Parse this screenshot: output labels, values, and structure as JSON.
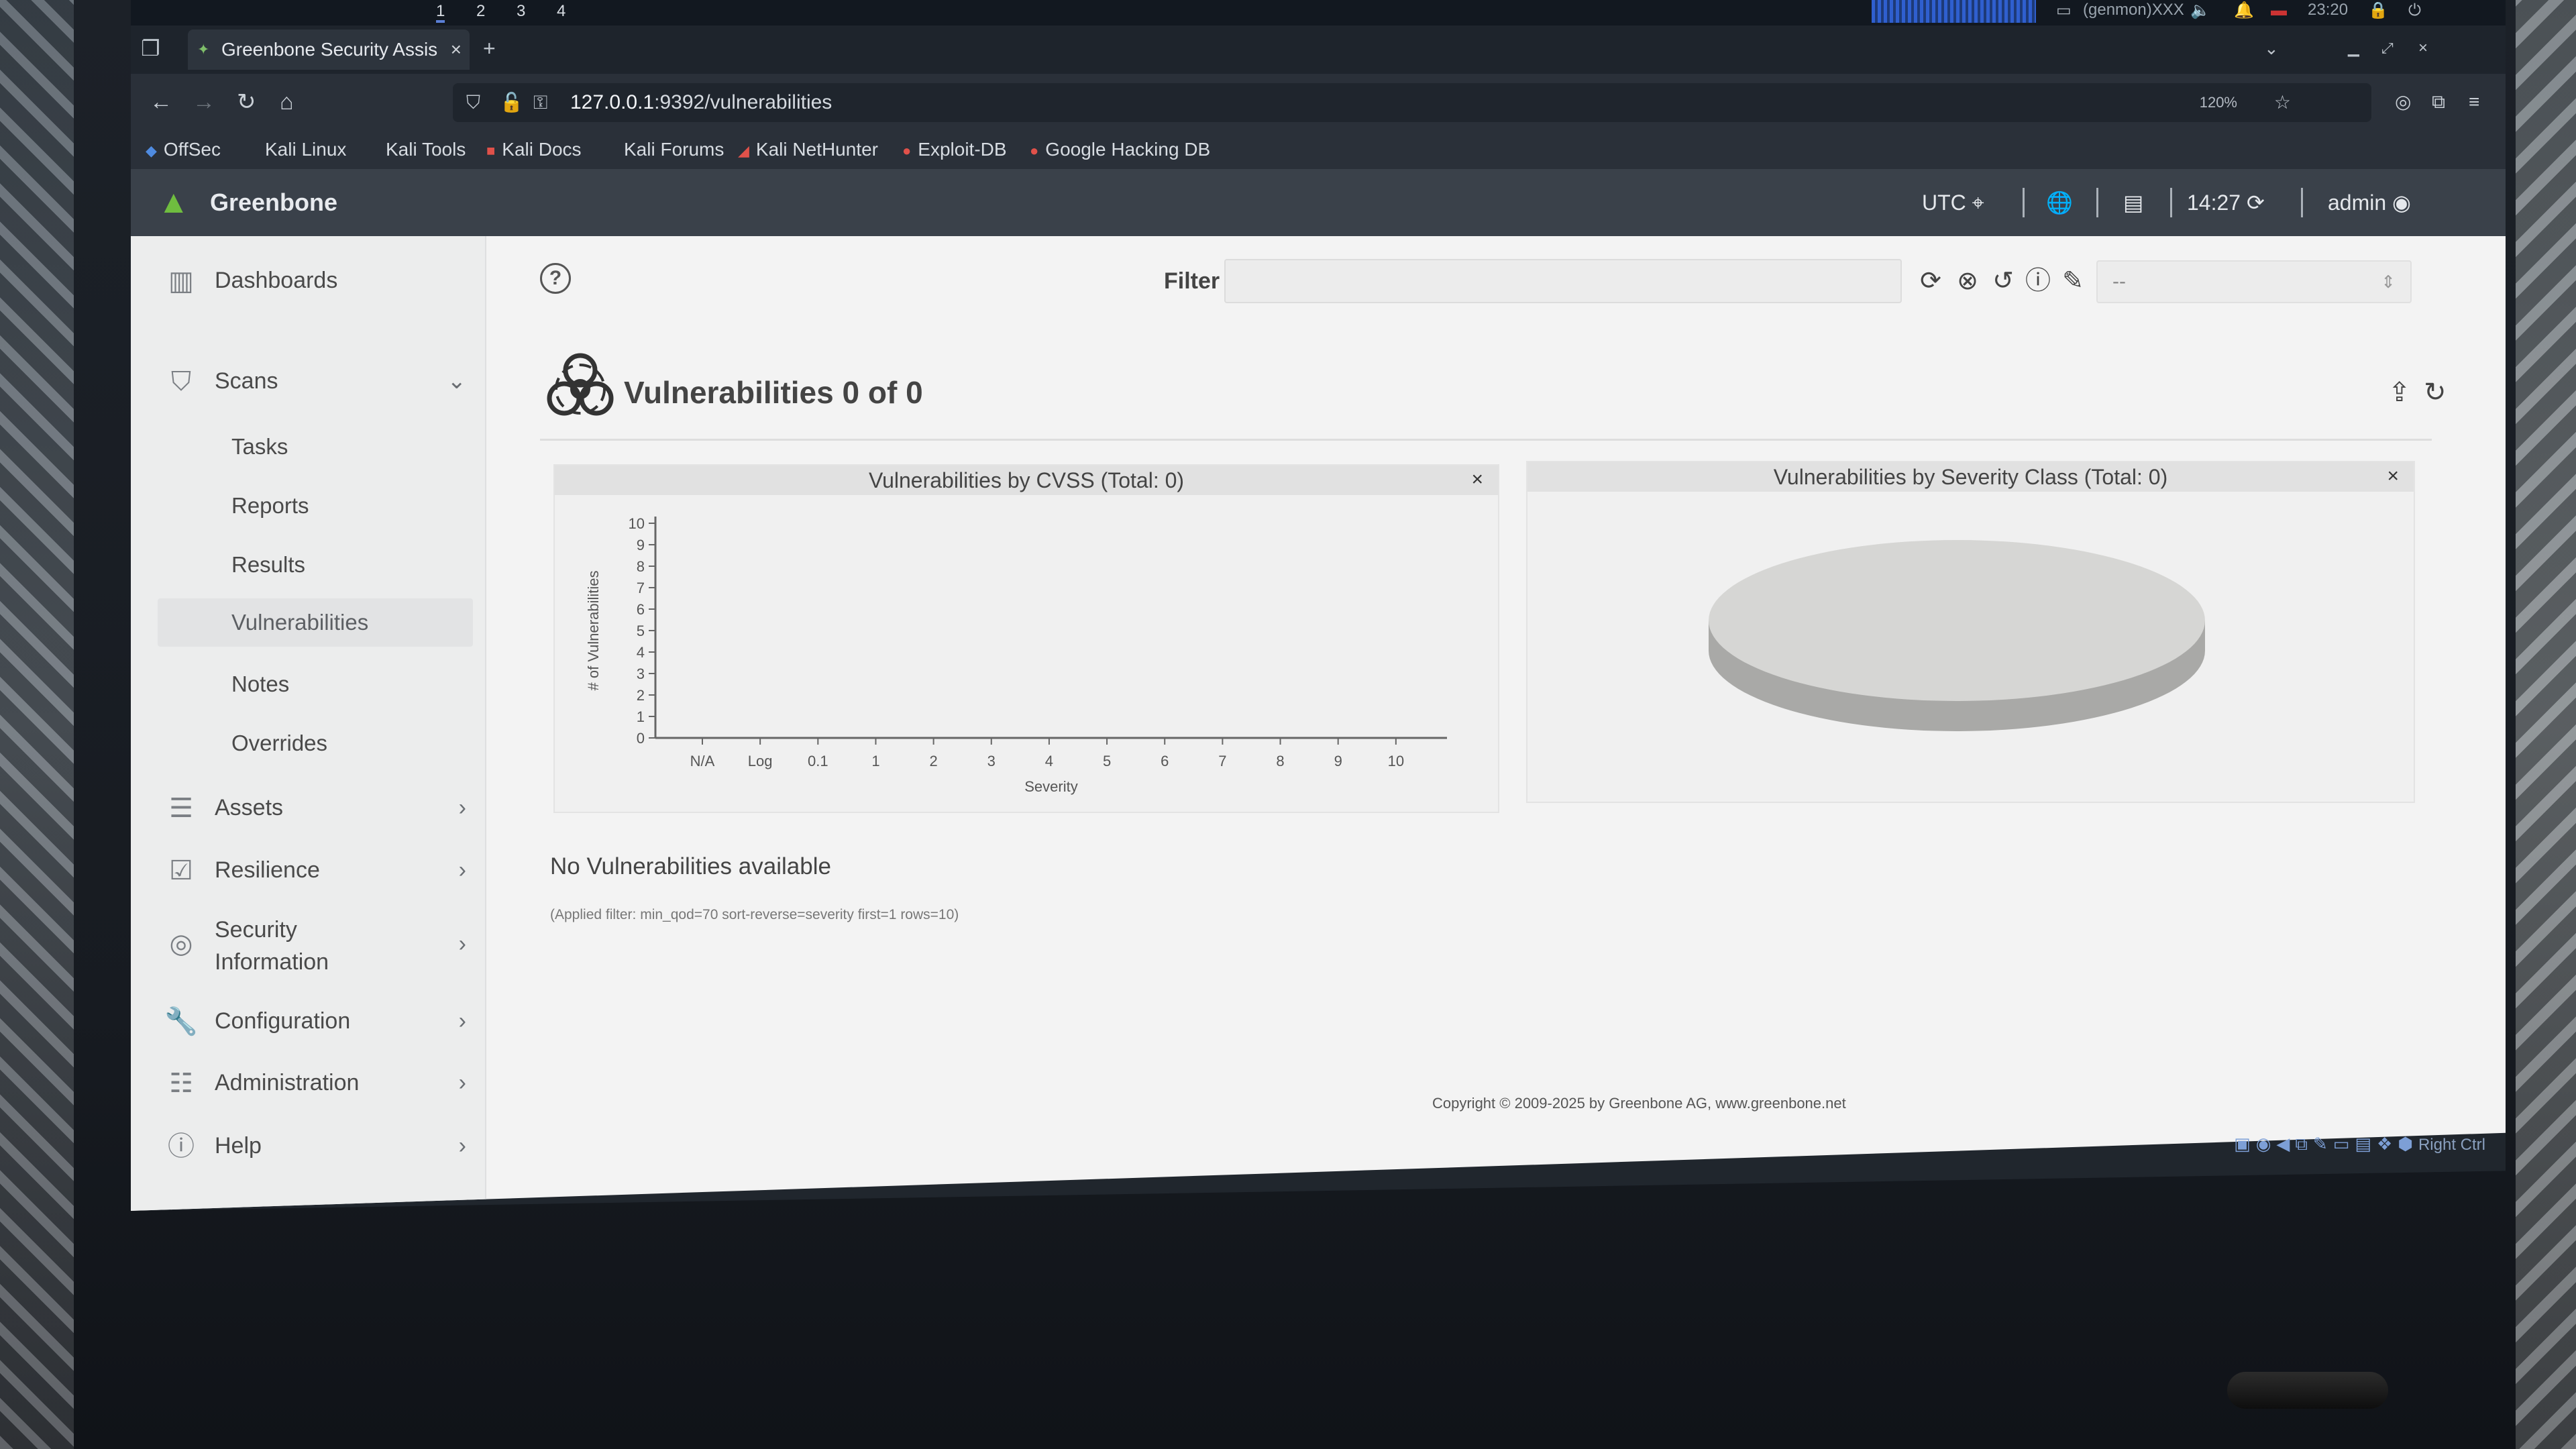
{
  "os_panel": {
    "workspaces": [
      "1",
      "2",
      "3",
      "4"
    ],
    "user": "(genmon)XXX",
    "clock": "23:20"
  },
  "browser": {
    "tab_title": "Greenbone Security Assis",
    "url_host": "127.0.0.1",
    "url_rest": ":9392/vulnerabilities",
    "zoom": "120%",
    "bookmarks": [
      "OffSec",
      "Kali Linux",
      "Kali Tools",
      "Kali Docs",
      "Kali Forums",
      "Kali NetHunter",
      "Exploit-DB",
      "Google Hacking DB"
    ]
  },
  "header": {
    "brand": "Greenbone",
    "timezone": "UTC",
    "time": "14:27",
    "user": "admin"
  },
  "sidebar": {
    "dashboards": "Dashboards",
    "scans": "Scans",
    "scans_items": [
      "Tasks",
      "Reports",
      "Results",
      "Vulnerabilities",
      "Notes",
      "Overrides"
    ],
    "assets": "Assets",
    "resilience": "Resilience",
    "security_info_1": "Security",
    "security_info_2": "Information",
    "configuration": "Configuration",
    "administration": "Administration",
    "help": "Help"
  },
  "toolbar": {
    "filter_label": "Filter",
    "filter_value": "",
    "filter_select": "--"
  },
  "page": {
    "title": "Vulnerabilities 0 of 0",
    "empty_message": "No Vulnerabilities available",
    "applied_filter": "(Applied filter: min_qod=70 sort-reverse=severity first=1 rows=10)",
    "copyright": "Copyright © 2009-2025 by Greenbone AG, www.greenbone.net"
  },
  "chart_data": [
    {
      "type": "bar",
      "title": "Vulnerabilities by CVSS (Total: 0)",
      "xlabel": "Severity",
      "ylabel": "# of Vulnerabilities",
      "categories": [
        "N/A",
        "Log",
        "0.1",
        "1",
        "2",
        "3",
        "4",
        "5",
        "6",
        "7",
        "8",
        "9",
        "10"
      ],
      "values": [
        0,
        0,
        0,
        0,
        0,
        0,
        0,
        0,
        0,
        0,
        0,
        0,
        0
      ],
      "ylim": [
        0,
        10
      ],
      "yticks": [
        "0",
        "1",
        "2",
        "3",
        "4",
        "5",
        "6",
        "7",
        "8",
        "9",
        "10"
      ]
    },
    {
      "type": "pie",
      "title": "Vulnerabilities by Severity Class (Total: 0)",
      "values": [],
      "empty_color": "#d6d6d4"
    }
  ],
  "taskbar": {
    "right_ctrl": "Right Ctrl"
  }
}
